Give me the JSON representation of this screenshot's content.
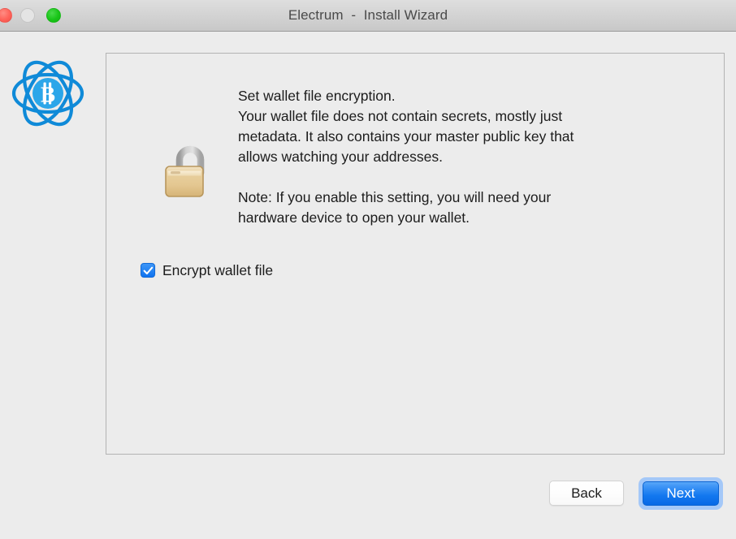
{
  "window": {
    "title": "Electrum  -  Install Wizard",
    "traffic_lights": [
      {
        "name": "close",
        "color": "#ff6259",
        "enabled": true
      },
      {
        "name": "minimize",
        "color": "#e4e4e4",
        "enabled": false
      },
      {
        "name": "zoom",
        "color": "#19c518",
        "enabled": true
      }
    ]
  },
  "sidebar": {
    "logo_icon": "electrum-bitcoin-atom-logo",
    "logo_color": "#0f8ad8"
  },
  "content": {
    "status_icon": "open-padlock-icon",
    "message_lines": [
      "Set wallet file encryption.",
      "Your wallet file does not contain secrets, mostly just",
      "metadata. It also contains your master public key that",
      "allows watching your addresses.",
      "",
      "Note: If you enable this setting, you will need your",
      "hardware device to open your wallet."
    ],
    "checkbox": {
      "label": "Encrypt wallet file",
      "checked": true,
      "accent_color": "#1073ef",
      "check_glyph": "✓"
    }
  },
  "buttons": {
    "back_label": "Back",
    "next_label": "Next",
    "next_is_default": true,
    "next_color": "#1277ef"
  }
}
